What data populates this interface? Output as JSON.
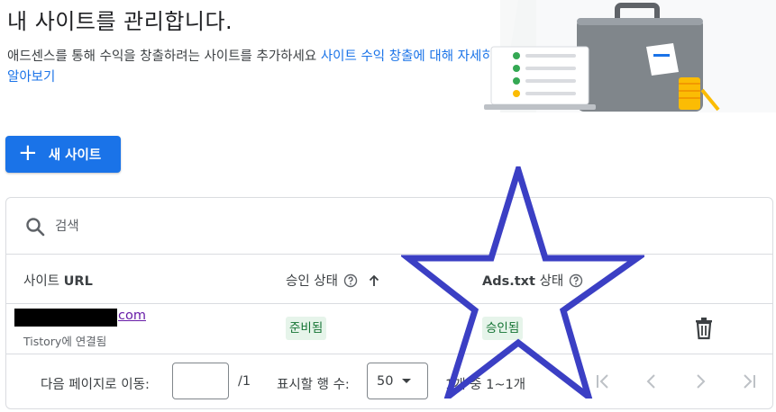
{
  "header": {
    "title": "내 사이트를 관리합니다.",
    "intro_text": "애드센스를 통해 수익을 창출하려는 사이트를 추가하세요 ",
    "intro_link": "사이트 수익 창출에 대해 자세히 알아보기"
  },
  "actions": {
    "new_site_label": "새 사이트"
  },
  "search": {
    "placeholder": "검색",
    "value": ""
  },
  "table": {
    "columns": {
      "url_prefix": "사이트 ",
      "url_bold": "URL",
      "approval": "승인 상태",
      "ads_bold": "Ads.txt",
      "ads_suffix": " 상태"
    },
    "rows": [
      {
        "url_visible": "com",
        "url_sub": "Tistory에 연결됨",
        "approval_status": "준비됨",
        "ads_status": "승인됨"
      }
    ]
  },
  "pagination": {
    "goto_label": "다음 페이지로 이동:",
    "goto_value": "",
    "goto_total": "/1",
    "rows_label": "표시할 행 수:",
    "rows_value": "50",
    "range_text": "1개 중 1~1개"
  },
  "icons": {
    "search": "search-icon",
    "help": "help-circle-icon",
    "sort": "arrow-up-icon",
    "delete": "trash-icon",
    "first": "first-page-icon",
    "prev": "chevron-left-icon",
    "next": "chevron-right-icon",
    "last": "last-page-icon"
  },
  "colors": {
    "primary": "#1a73e8",
    "chip_bg": "#e6f4ea",
    "chip_text": "#137333",
    "star": "#3b3fc4"
  }
}
